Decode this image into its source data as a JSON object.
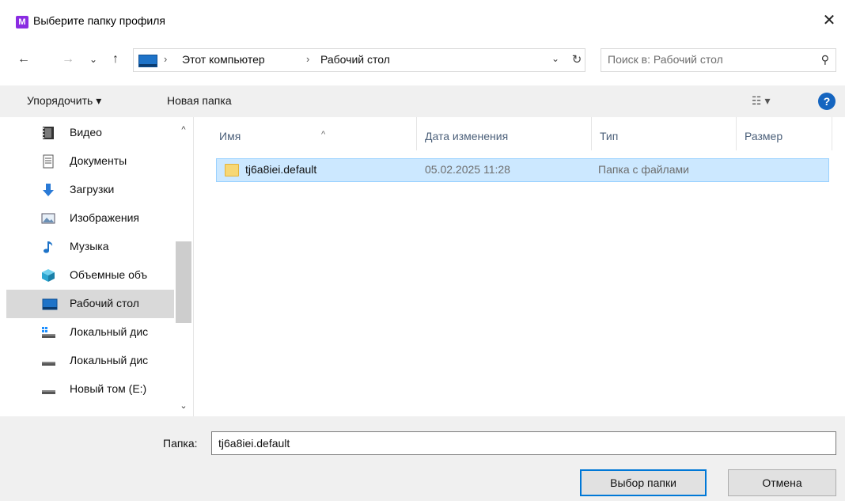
{
  "window": {
    "title": "Выберите папку профиля",
    "app_icon_letter": "M",
    "close_glyph": "✕"
  },
  "nav": {
    "back_glyph": "←",
    "forward_glyph": "→",
    "recent_glyph": "⌄",
    "up_glyph": "↑",
    "breadcrumb": [
      "Этот компьютер",
      "Рабочий стол"
    ],
    "separator": "›",
    "dropdown_glyph": "⌄",
    "refresh_glyph": "↻",
    "search_placeholder": "Поиск в: Рабочий стол",
    "search_glyph": "⚲"
  },
  "toolbar": {
    "organize_label": "Упорядочить ▾",
    "new_folder_label": "Новая папка",
    "view_glyph": "☷ ▾",
    "help_glyph": "?"
  },
  "sidebar": {
    "items": [
      {
        "label": "Видео",
        "icon": "video-icon"
      },
      {
        "label": "Документы",
        "icon": "documents-icon"
      },
      {
        "label": "Загрузки",
        "icon": "downloads-icon"
      },
      {
        "label": "Изображения",
        "icon": "pictures-icon"
      },
      {
        "label": "Музыка",
        "icon": "music-icon"
      },
      {
        "label": "Объемные объ",
        "icon": "3d-objects-icon"
      },
      {
        "label": "Рабочий стол",
        "icon": "desktop-icon",
        "selected": true
      },
      {
        "label": "Локальный дис",
        "icon": "local-disk-icon"
      },
      {
        "label": "Локальный дис",
        "icon": "local-disk-icon"
      },
      {
        "label": "Новый том (E:)",
        "icon": "drive-icon"
      }
    ],
    "scroll_up_glyph": "^",
    "scroll_down_glyph": "⌄"
  },
  "columns": {
    "name": "Имя",
    "date": "Дата изменения",
    "type": "Тип",
    "size": "Размер",
    "sort_glyph": "^"
  },
  "files": [
    {
      "name": "tj6a8iei.default",
      "date": "05.02.2025 11:28",
      "type": "Папка с файлами",
      "size": ""
    }
  ],
  "footer": {
    "folder_label": "Папка:",
    "folder_value": "tj6a8iei.default",
    "select_button": "Выбор папки",
    "cancel_button": "Отмена"
  },
  "colors": {
    "accent": "#0078d7",
    "selection_bg": "#cce8ff",
    "selection_border": "#99d1ff"
  }
}
